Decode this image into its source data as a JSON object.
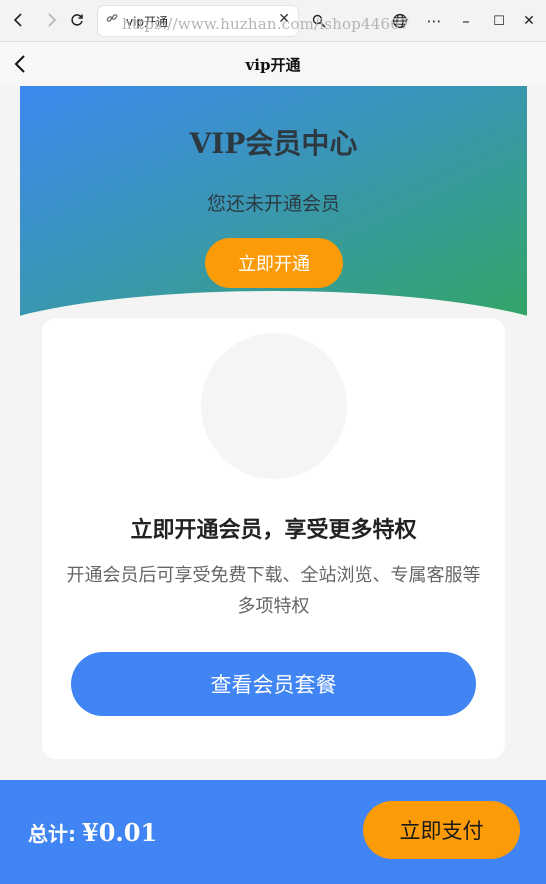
{
  "browser": {
    "tab_title": "vip开通",
    "tab_close": "✕",
    "address_overlay": "https://www.huzhan.com/ishop44667",
    "more": "⋯",
    "minimize": "–",
    "maximize": "☐",
    "close": "✕"
  },
  "header": {
    "title": "vip开通"
  },
  "banner": {
    "title": "VIP会员中心",
    "status": "您还未开通会员",
    "open_button": "立即开通"
  },
  "card": {
    "heading": "立即开通会员，享受更多特权",
    "description": "开通会员后可享受免费下载、全站浏览、专属客服等多项特权",
    "plans_button": "查看会员套餐"
  },
  "pay_bar": {
    "total_label": "总计:",
    "total_amount": "¥0.01",
    "pay_button": "立即支付"
  },
  "colors": {
    "primary_blue": "#4184f3",
    "accent_orange": "#fb9b08",
    "banner_gradient_start": "#3d88ef",
    "banner_gradient_end": "#32a564"
  },
  "icons": [
    "back-icon",
    "forward-icon",
    "reload-icon",
    "link-icon",
    "search-icon",
    "globe-icon",
    "more-icon",
    "minimize-icon",
    "maximize-icon",
    "window-close-icon",
    "header-back-icon"
  ]
}
